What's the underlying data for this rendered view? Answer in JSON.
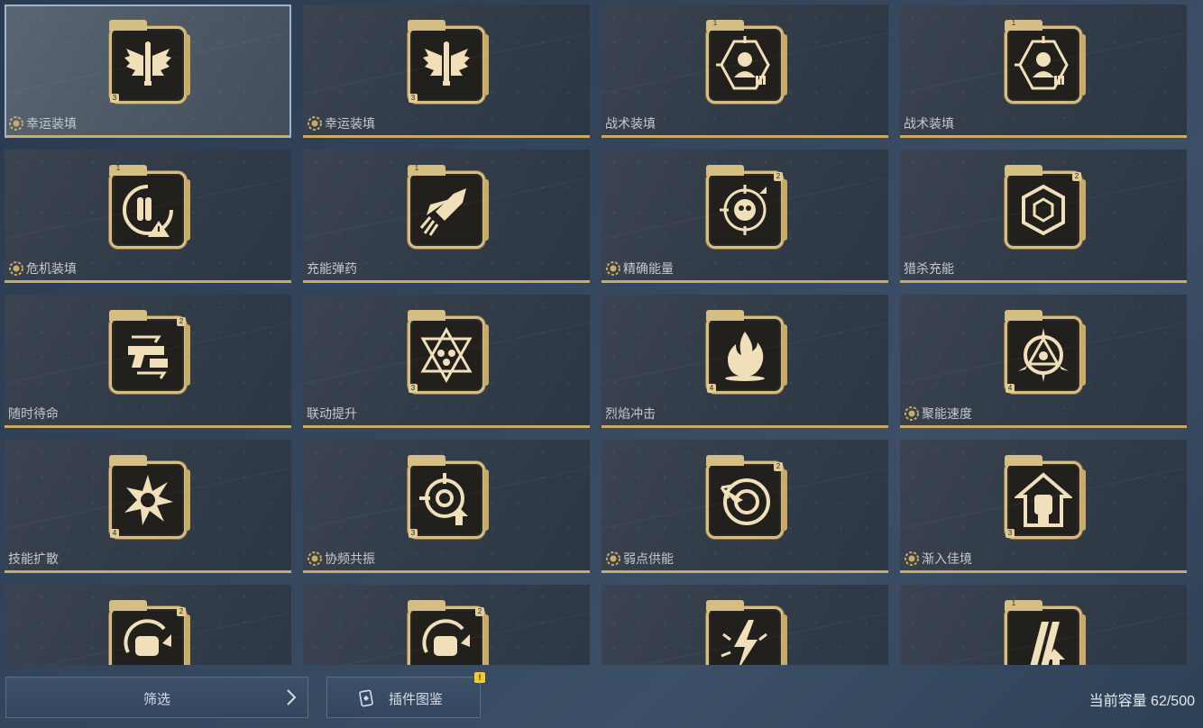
{
  "grid": {
    "cards": [
      {
        "name": "幸运装填",
        "favorited": true,
        "selected": true,
        "icon": "wing-bullet-icon",
        "rank": "3",
        "rank_pos": "bl"
      },
      {
        "name": "幸运装填",
        "favorited": true,
        "selected": false,
        "icon": "wing-bullet-icon",
        "rank": "3",
        "rank_pos": "bl"
      },
      {
        "name": "战术装填",
        "favorited": false,
        "selected": false,
        "icon": "crosshair-person-icon",
        "rank": "1",
        "rank_pos": "tl"
      },
      {
        "name": "战术装填",
        "favorited": false,
        "selected": false,
        "icon": "crosshair-person-icon",
        "rank": "1",
        "rank_pos": "tl"
      },
      {
        "name": "危机装填",
        "favorited": true,
        "selected": false,
        "icon": "reload-warning-icon",
        "rank": "1",
        "rank_pos": "tl"
      },
      {
        "name": "充能弹药",
        "favorited": false,
        "selected": false,
        "icon": "rocket-bullet-icon",
        "rank": "1",
        "rank_pos": "tl"
      },
      {
        "name": "精确能量",
        "favorited": true,
        "selected": false,
        "icon": "skull-target-icon",
        "rank": "2",
        "rank_pos": "tr"
      },
      {
        "name": "猎杀充能",
        "favorited": false,
        "selected": false,
        "icon": "hex-target-icon",
        "rank": "2",
        "rank_pos": "tr"
      },
      {
        "name": "随时待命",
        "favorited": false,
        "selected": false,
        "icon": "pistol-ammo-icon",
        "rank": "2",
        "rank_pos": "tr"
      },
      {
        "name": "联动提升",
        "favorited": false,
        "selected": false,
        "icon": "star-triangle-icon",
        "rank": "3",
        "rank_pos": "bl"
      },
      {
        "name": "烈焰冲击",
        "favorited": false,
        "selected": false,
        "icon": "flame-icon",
        "rank": "4",
        "rank_pos": "bl"
      },
      {
        "name": "聚能速度",
        "favorited": true,
        "selected": false,
        "icon": "spiked-triangle-icon",
        "rank": "4",
        "rank_pos": "bl"
      },
      {
        "name": "技能扩散",
        "favorited": false,
        "selected": false,
        "icon": "explosion-icon",
        "rank": "4",
        "rank_pos": "bl"
      },
      {
        "name": "协频共振",
        "favorited": true,
        "selected": false,
        "icon": "target-arrow-icon",
        "rank": "3",
        "rank_pos": "bl"
      },
      {
        "name": "弱点供能",
        "favorited": true,
        "selected": false,
        "icon": "bullseye-arrow-icon",
        "rank": "2",
        "rank_pos": "tr"
      },
      {
        "name": "渐入佳境",
        "favorited": true,
        "selected": false,
        "icon": "fist-house-icon",
        "rank": "3",
        "rank_pos": "bl"
      },
      {
        "name": "",
        "favorited": false,
        "selected": false,
        "icon": "fist-rotate-icon",
        "rank": "2",
        "rank_pos": "tr"
      },
      {
        "name": "",
        "favorited": false,
        "selected": false,
        "icon": "fist-rotate-icon",
        "rank": "2",
        "rank_pos": "tr"
      },
      {
        "name": "",
        "favorited": false,
        "selected": false,
        "icon": "lightning-burst-icon",
        "rank": "",
        "rank_pos": "bl"
      },
      {
        "name": "",
        "favorited": false,
        "selected": false,
        "icon": "claw-arrow-icon",
        "rank": "1",
        "rank_pos": "tl"
      }
    ]
  },
  "bottombar": {
    "filter_label": "筛选",
    "codex_label": "插件图鉴",
    "codex_alert": "!",
    "capacity_text": "当前容量 62/500"
  },
  "colors": {
    "gold": "#d6bd84",
    "chip_bg": "#22201d",
    "accent_warn": "#f1cc2c"
  }
}
